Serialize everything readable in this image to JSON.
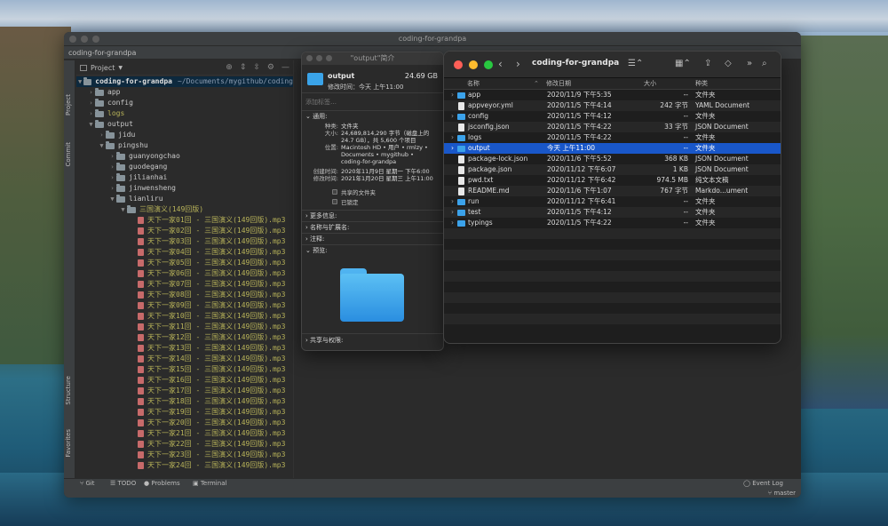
{
  "ide": {
    "window_title": "coding-for-grandpa",
    "breadcrumb": "coding-for-grandpa",
    "project_label": "Project",
    "left_tabs": [
      "Project",
      "Commit",
      "Structure",
      "Favorites",
      "npm"
    ],
    "root": "coding-for-grandpa",
    "root_path": "~/Documents/mygithub/coding",
    "tree": [
      {
        "label": "app",
        "type": "folder",
        "indent": 1,
        "open": false
      },
      {
        "label": "config",
        "type": "folder",
        "indent": 1,
        "open": false
      },
      {
        "label": "logs",
        "type": "folder",
        "indent": 1,
        "open": false,
        "style": "logs"
      },
      {
        "label": "output",
        "type": "folder",
        "indent": 1,
        "open": true
      },
      {
        "label": "jidu",
        "type": "folder",
        "indent": 2,
        "open": false
      },
      {
        "label": "pingshu",
        "type": "folder",
        "indent": 2,
        "open": true
      },
      {
        "label": "guanyongchao",
        "type": "folder",
        "indent": 3,
        "open": false
      },
      {
        "label": "guodegang",
        "type": "folder",
        "indent": 3,
        "open": false
      },
      {
        "label": "jilianhai",
        "type": "folder",
        "indent": 3,
        "open": false
      },
      {
        "label": "jinwensheng",
        "type": "folder",
        "indent": 3,
        "open": false
      },
      {
        "label": "lianliru",
        "type": "folder",
        "indent": 3,
        "open": true
      },
      {
        "label": "三国演义(149回版)",
        "type": "folder",
        "indent": 4,
        "open": true,
        "style": "file"
      },
      {
        "label": "天下一家01回 - 三国演义(149回版).mp3",
        "type": "mp3",
        "indent": 5
      },
      {
        "label": "天下一家02回 - 三国演义(149回版).mp3",
        "type": "mp3",
        "indent": 5
      },
      {
        "label": "天下一家03回 - 三国演义(149回版).mp3",
        "type": "mp3",
        "indent": 5
      },
      {
        "label": "天下一家04回 - 三国演义(149回版).mp3",
        "type": "mp3",
        "indent": 5
      },
      {
        "label": "天下一家05回 - 三国演义(149回版).mp3",
        "type": "mp3",
        "indent": 5
      },
      {
        "label": "天下一家06回 - 三国演义(149回版).mp3",
        "type": "mp3",
        "indent": 5
      },
      {
        "label": "天下一家07回 - 三国演义(149回版).mp3",
        "type": "mp3",
        "indent": 5
      },
      {
        "label": "天下一家08回 - 三国演义(149回版).mp3",
        "type": "mp3",
        "indent": 5
      },
      {
        "label": "天下一家09回 - 三国演义(149回版).mp3",
        "type": "mp3",
        "indent": 5
      },
      {
        "label": "天下一家10回 - 三国演义(149回版).mp3",
        "type": "mp3",
        "indent": 5
      },
      {
        "label": "天下一家11回 - 三国演义(149回版).mp3",
        "type": "mp3",
        "indent": 5
      },
      {
        "label": "天下一家12回 - 三国演义(149回版).mp3",
        "type": "mp3",
        "indent": 5
      },
      {
        "label": "天下一家13回 - 三国演义(149回版).mp3",
        "type": "mp3",
        "indent": 5
      },
      {
        "label": "天下一家14回 - 三国演义(149回版).mp3",
        "type": "mp3",
        "indent": 5
      },
      {
        "label": "天下一家15回 - 三国演义(149回版).mp3",
        "type": "mp3",
        "indent": 5
      },
      {
        "label": "天下一家16回 - 三国演义(149回版).mp3",
        "type": "mp3",
        "indent": 5
      },
      {
        "label": "天下一家17回 - 三国演义(149回版).mp3",
        "type": "mp3",
        "indent": 5
      },
      {
        "label": "天下一家18回 - 三国演义(149回版).mp3",
        "type": "mp3",
        "indent": 5
      },
      {
        "label": "天下一家19回 - 三国演义(149回版).mp3",
        "type": "mp3",
        "indent": 5
      },
      {
        "label": "天下一家20回 - 三国演义(149回版).mp3",
        "type": "mp3",
        "indent": 5
      },
      {
        "label": "天下一家21回 - 三国演义(149回版).mp3",
        "type": "mp3",
        "indent": 5
      },
      {
        "label": "天下一家22回 - 三国演义(149回版).mp3",
        "type": "mp3",
        "indent": 5
      },
      {
        "label": "天下一家23回 - 三国演义(149回版).mp3",
        "type": "mp3",
        "indent": 5
      },
      {
        "label": "天下一家24回 - 三国演义(149回版).mp3",
        "type": "mp3",
        "indent": 5
      }
    ],
    "bottom_tabs": [
      "Git",
      "TODO",
      "Problems",
      "Terminal"
    ],
    "event_log": "Event Log",
    "branch": "master"
  },
  "info": {
    "window_title": "\"output\"简介",
    "name": "output",
    "size": "24.69 GB",
    "modified": "修改时间：今天 上午11:00",
    "tags_placeholder": "添加标签…",
    "general_label": "通用:",
    "fields": [
      {
        "k": "种类:",
        "v": "文件夹"
      },
      {
        "k": "大小:",
        "v": "24,689,814,290 字节（磁盘上的 24.7 GB），共 5,600 个项目"
      },
      {
        "k": "位置:",
        "v": "Macintosh HD • 用户 • rmlzy • Documents • mygithub • coding-for-grandpa"
      },
      {
        "k": "创建时间:",
        "v": "2020年11月9日 星期一 下午6:00"
      },
      {
        "k": "修改时间:",
        "v": "2021年1月20日 星期三 上午11:00"
      }
    ],
    "checkboxes": [
      "共享的文件夹",
      "已锁定"
    ],
    "sections": [
      "更多信息:",
      "名称与扩展名:",
      "注释:",
      "预览:"
    ],
    "sharing": "共享与权限:"
  },
  "finder": {
    "title": "coding-for-grandpa",
    "columns": [
      "名称",
      "修改日期",
      "大小",
      "种类"
    ],
    "rows": [
      {
        "name": "app",
        "icon": "folder",
        "date": "2020/11/9 下午5:35",
        "size": "--",
        "kind": "文件夹",
        "expand": true
      },
      {
        "name": "appveyor.yml",
        "icon": "file",
        "date": "2020/11/5 下午4:14",
        "size": "242 字节",
        "kind": "YAML Document",
        "expand": false
      },
      {
        "name": "config",
        "icon": "folder",
        "date": "2020/11/5 下午4:12",
        "size": "--",
        "kind": "文件夹",
        "expand": true
      },
      {
        "name": "jsconfig.json",
        "icon": "file",
        "date": "2020/11/5 下午4:22",
        "size": "33 字节",
        "kind": "JSON Document",
        "expand": false
      },
      {
        "name": "logs",
        "icon": "folder",
        "date": "2020/11/5 下午4:22",
        "size": "--",
        "kind": "文件夹",
        "expand": true
      },
      {
        "name": "output",
        "icon": "folder",
        "date": "今天 上午11:00",
        "size": "--",
        "kind": "文件夹",
        "expand": true,
        "selected": true
      },
      {
        "name": "package-lock.json",
        "icon": "file",
        "date": "2020/11/6 下午5:52",
        "size": "368 KB",
        "kind": "JSON Document",
        "expand": false
      },
      {
        "name": "package.json",
        "icon": "file",
        "date": "2020/11/12 下午6:07",
        "size": "1 KB",
        "kind": "JSON Document",
        "expand": false
      },
      {
        "name": "pwd.txt",
        "icon": "file",
        "date": "2020/11/12 下午6:42",
        "size": "974.5 MB",
        "kind": "纯文本文稿",
        "expand": false
      },
      {
        "name": "README.md",
        "icon": "file",
        "date": "2020/11/6 下午1:07",
        "size": "767 字节",
        "kind": "Markdo...ument",
        "expand": false
      },
      {
        "name": "run",
        "icon": "folder",
        "date": "2020/11/12 下午6:41",
        "size": "--",
        "kind": "文件夹",
        "expand": true
      },
      {
        "name": "test",
        "icon": "folder",
        "date": "2020/11/5 下午4:12",
        "size": "--",
        "kind": "文件夹",
        "expand": true
      },
      {
        "name": "typings",
        "icon": "folder",
        "date": "2020/11/5 下午4:22",
        "size": "--",
        "kind": "文件夹",
        "expand": true
      }
    ]
  }
}
